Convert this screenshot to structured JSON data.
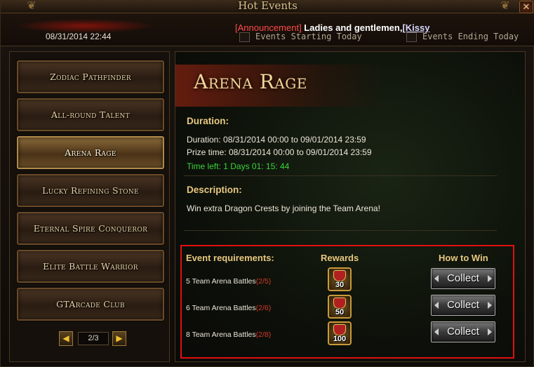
{
  "window": {
    "title": "Hot Events",
    "close_glyph": "✕",
    "corner_glyph": "❦"
  },
  "header": {
    "datetime": "08/31/2014 22:44",
    "announcement_tag": "[Announcement]",
    "announcement_text": " Ladies and gentlemen,",
    "announcement_name": "[Kissy",
    "filter_starting": "Events Starting Today",
    "filter_ending": "Events Ending Today"
  },
  "sidebar": {
    "items": [
      {
        "label": "Zodiac Pathfinder",
        "active": false
      },
      {
        "label": "All-round Talent",
        "active": false
      },
      {
        "label": "Arena Rage",
        "active": true
      },
      {
        "label": "Lucky Refining Stone",
        "active": false
      },
      {
        "label": "Eternal Spire Conqueror",
        "active": false
      },
      {
        "label": "Elite Battle Warrior",
        "active": false
      },
      {
        "label": "GTArcade Club",
        "active": false
      }
    ],
    "pager": {
      "prev": "◀",
      "label": "2/3",
      "next": "▶"
    }
  },
  "event": {
    "title": "Arena Rage",
    "duration_label": "Duration:",
    "duration": "Duration: 08/31/2014 00:00 to 09/01/2014 23:59",
    "prize_time": "Prize time: 08/31/2014 00:00 to 09/01/2014 23:59",
    "time_left": "Time left: 1 Days  01: 15: 44",
    "description_label": "Description:",
    "description": "Win extra Dragon Crests by joining the Team Arena!"
  },
  "requirements": {
    "col_requirements": "Event requirements:",
    "col_rewards": "Rewards",
    "col_how": "How to Win",
    "rows": [
      {
        "text": "5 Team Arena Battles",
        "progress": "(2/5)",
        "reward": "30",
        "button": "Collect"
      },
      {
        "text": "6 Team Arena Battles",
        "progress": "(2/6)",
        "reward": "50",
        "button": "Collect"
      },
      {
        "text": "8 Team Arena Battles",
        "progress": "(2/8)",
        "reward": "100",
        "button": "Collect"
      }
    ]
  },
  "colors": {
    "highlight_border": "#e01010",
    "time_left": "#39d339",
    "progress": "#d43a2a",
    "announcement_tag": "#ff4a4a"
  }
}
